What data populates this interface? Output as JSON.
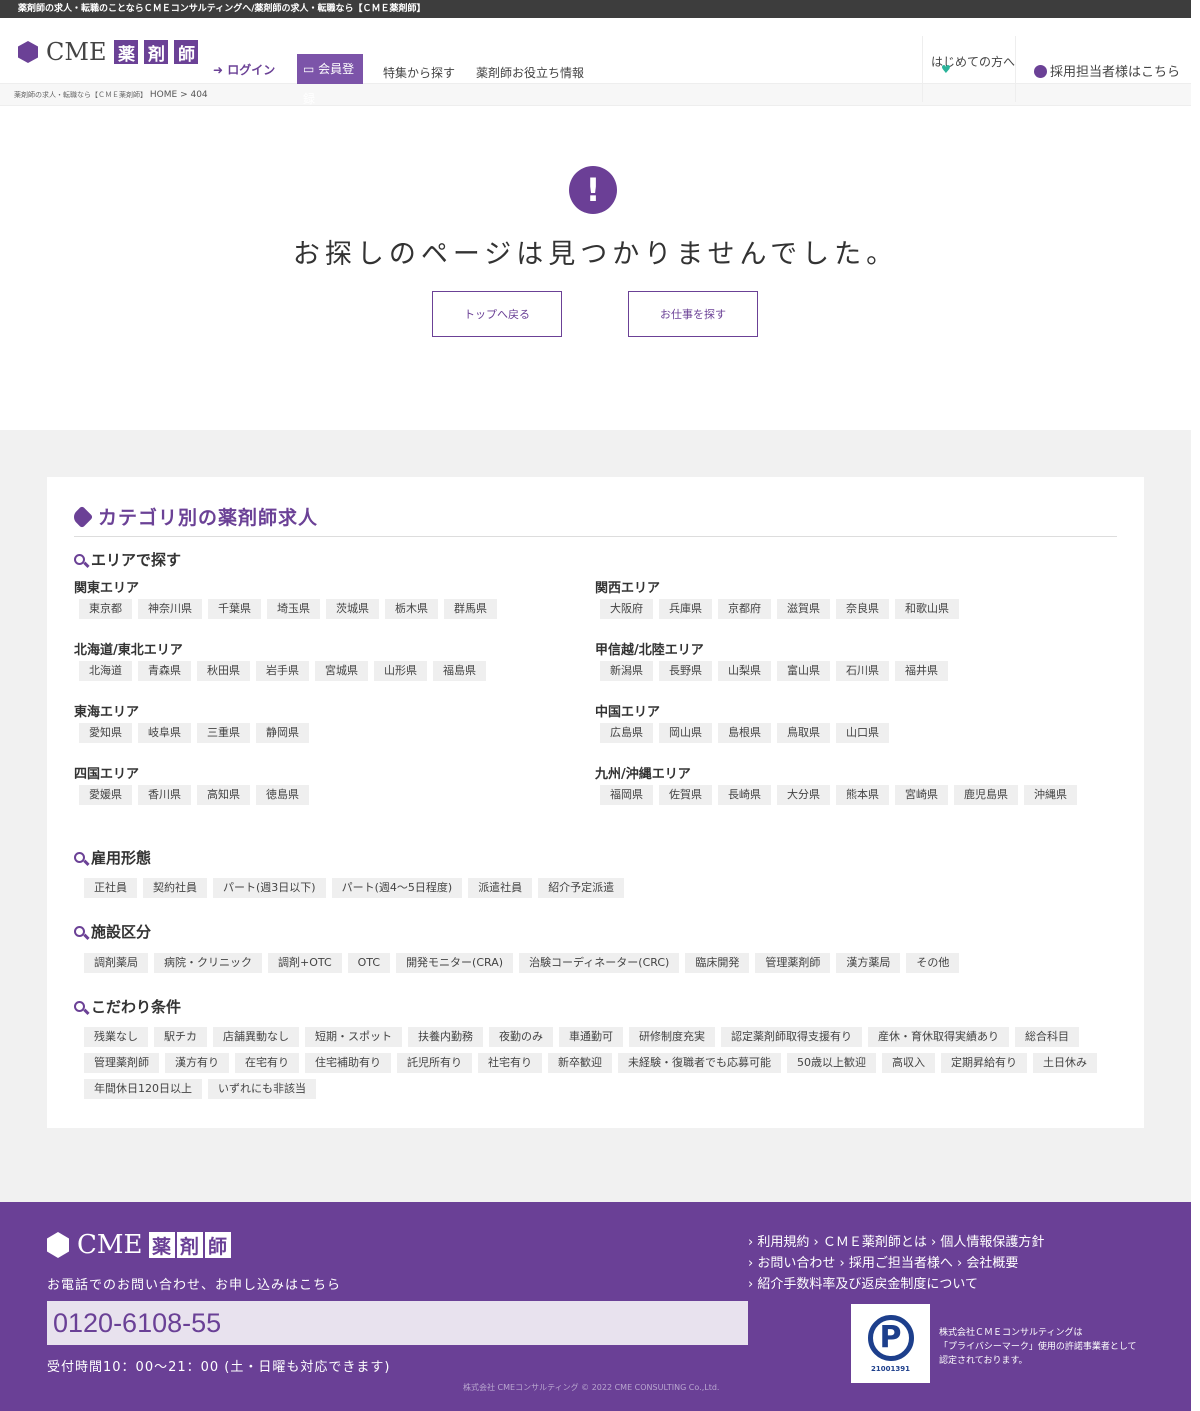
{
  "topbar": {
    "text": "薬剤師の求人・転職のことならＣＭＥコンサルティングへ/薬剤師の求人・転職なら【ＣＭＥ薬剤師】"
  },
  "header": {
    "logo_text": "CME",
    "logo_kanji": [
      "薬",
      "剤",
      "師"
    ],
    "login": "ログイン",
    "register": "会員登録",
    "feature": "特集から探す",
    "info": "薬剤師お役立ち情報",
    "first": "はじめての方へ",
    "employer": "採用担当者様はこちら"
  },
  "breadcrumb": {
    "site": "薬剤師の求人・転職なら【ＣＭＥ薬剤師】",
    "home": "HOME",
    "sep": ">",
    "current": "404"
  },
  "notfound": {
    "icon": "!",
    "message": "お探しのページは見つかりませんでした。",
    "back_top": "トップへ戻る",
    "find_job": "お仕事を探す"
  },
  "category": {
    "title": "カテゴリ別の薬剤師求人",
    "area_heading": "エリアで探す",
    "areas": [
      {
        "name": "関東エリア",
        "items": [
          "東京都",
          "神奈川県",
          "千葉県",
          "埼玉県",
          "茨城県",
          "栃木県",
          "群馬県"
        ]
      },
      {
        "name": "関西エリア",
        "items": [
          "大阪府",
          "兵庫県",
          "京都府",
          "滋賀県",
          "奈良県",
          "和歌山県"
        ]
      },
      {
        "name": "北海道/東北エリア",
        "items": [
          "北海道",
          "青森県",
          "秋田県",
          "岩手県",
          "宮城県",
          "山形県",
          "福島県"
        ]
      },
      {
        "name": "甲信越/北陸エリア",
        "items": [
          "新潟県",
          "長野県",
          "山梨県",
          "富山県",
          "石川県",
          "福井県"
        ]
      },
      {
        "name": "東海エリア",
        "items": [
          "愛知県",
          "岐阜県",
          "三重県",
          "静岡県"
        ]
      },
      {
        "name": "中国エリア",
        "items": [
          "広島県",
          "岡山県",
          "島根県",
          "鳥取県",
          "山口県"
        ]
      },
      {
        "name": "四国エリア",
        "items": [
          "愛媛県",
          "香川県",
          "高知県",
          "徳島県"
        ]
      },
      {
        "name": "九州/沖縄エリア",
        "items": [
          "福岡県",
          "佐賀県",
          "長崎県",
          "大分県",
          "熊本県",
          "宮崎県",
          "鹿児島県",
          "沖縄県"
        ]
      }
    ],
    "employment_heading": "雇用形態",
    "employment": [
      "正社員",
      "契約社員",
      "パート(週3日以下)",
      "パート(週4～5日程度)",
      "派遣社員",
      "紹介予定派遣"
    ],
    "facility_heading": "施設区分",
    "facility": [
      "調剤薬局",
      "病院・クリニック",
      "調剤+OTC",
      "OTC",
      "開発モニター(CRA)",
      "治験コーディネーター(CRC)",
      "臨床開発",
      "管理薬剤師",
      "漢方薬局",
      "その他"
    ],
    "conditions_heading": "こだわり条件",
    "conditions": [
      "残業なし",
      "駅チカ",
      "店舗異動なし",
      "短期・スポット",
      "扶養内勤務",
      "夜勤のみ",
      "車通勤可",
      "研修制度充実",
      "認定薬剤師取得支援有り",
      "産休・育休取得実績あり",
      "総合科目",
      "管理薬剤師",
      "漢方有り",
      "在宅有り",
      "住宅補助有り",
      "託児所有り",
      "社宅有り",
      "新卒歓迎",
      "未経験・復職者でも応募可能",
      "50歳以上歓迎",
      "高収入",
      "定期昇給有り",
      "土日休み",
      "年間休日120日以上",
      "いずれにも非該当"
    ]
  },
  "footer": {
    "logo_text": "CME",
    "logo_kanji": [
      "薬",
      "剤",
      "師"
    ],
    "tel_label": "お電話でのお問い合わせ、お申し込みはこちら",
    "tel": "0120-6108-55",
    "hours": "受付時間10：00～21：00 (土・日曜も対応できます)",
    "links": [
      [
        "利用規約",
        "ＣＭＥ薬剤師とは",
        "個人情報保護方針"
      ],
      [
        "お問い合わせ",
        "採用ご担当者様へ",
        "会社概要"
      ],
      [
        "紹介手数料率及び返戻金制度について"
      ]
    ],
    "pmark_number": "21001391",
    "pmark_text": [
      "株式会社ＣＭＥコンサルティングは",
      "「プライバシーマーク」使用の許諾事業者として",
      "認定されております。"
    ],
    "copyright": "株式会社 CMEコンサルティング © 2022 CME CONSULTING Co.,Ltd."
  },
  "colors": {
    "brand": "#6b4196",
    "topbar": "#3d3d3d",
    "tag_bg": "#efefef",
    "section_bg": "#f1f1f1"
  }
}
